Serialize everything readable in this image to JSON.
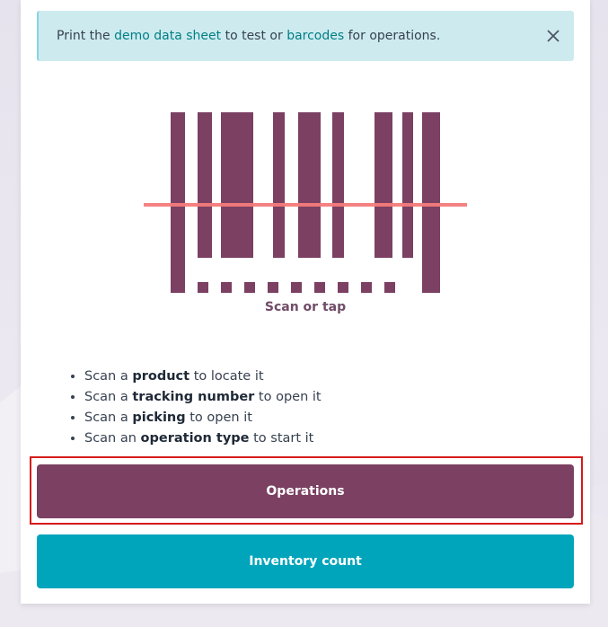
{
  "alert": {
    "text_1": "Print the ",
    "link_demo": "demo data sheet",
    "text_2": " to test or ",
    "link_barcodes": "barcodes",
    "text_3": " for operations."
  },
  "scanner": {
    "label": "Scan or tap"
  },
  "tips": [
    {
      "pre": "Scan a ",
      "bold": "product",
      "post": " to locate it"
    },
    {
      "pre": "Scan a ",
      "bold": "tracking number",
      "post": " to open it"
    },
    {
      "pre": "Scan a ",
      "bold": "picking",
      "post": " to open it"
    },
    {
      "pre": "Scan an ",
      "bold": "operation type",
      "post": " to start it"
    }
  ],
  "buttons": {
    "operations": "Operations",
    "inventory_count": "Inventory count"
  },
  "colors": {
    "barcode": "#7b4062",
    "scan_line": "#f47b7b",
    "operations_button": "#7b4062",
    "inventory_button": "#00a5bb",
    "alert_bg": "#cdebef",
    "link": "#017e84"
  }
}
